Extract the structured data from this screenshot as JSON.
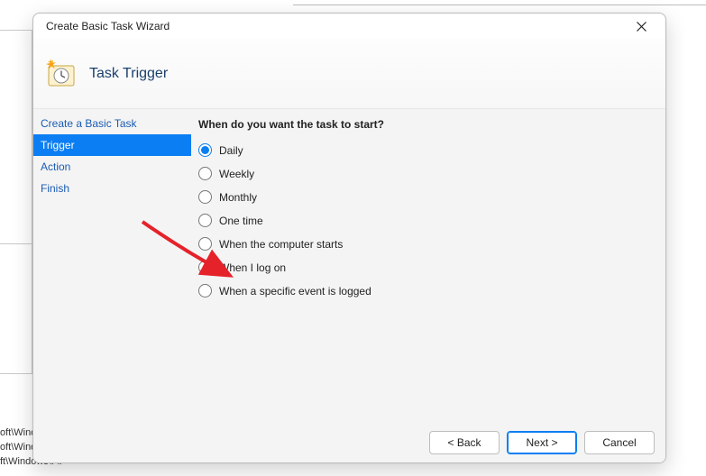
{
  "background": {
    "lines": [
      "oft\\Winc",
      "oft\\Windows\\U...",
      "ft\\Windows\\Fli"
    ]
  },
  "dialog": {
    "title": "Create Basic Task Wizard",
    "header": "Task Trigger",
    "nav": [
      {
        "label": "Create a Basic Task",
        "selected": false
      },
      {
        "label": "Trigger",
        "selected": true
      },
      {
        "label": "Action",
        "selected": false
      },
      {
        "label": "Finish",
        "selected": false
      }
    ],
    "prompt": "When do you want the task to start?",
    "options": [
      {
        "label": "Daily",
        "checked": true
      },
      {
        "label": "Weekly",
        "checked": false
      },
      {
        "label": "Monthly",
        "checked": false
      },
      {
        "label": "One time",
        "checked": false
      },
      {
        "label": "When the computer starts",
        "checked": false
      },
      {
        "label": "When I log on",
        "checked": false
      },
      {
        "label": "When a specific event is logged",
        "checked": false
      }
    ],
    "buttons": {
      "back": "< Back",
      "next": "Next >",
      "cancel": "Cancel"
    }
  }
}
